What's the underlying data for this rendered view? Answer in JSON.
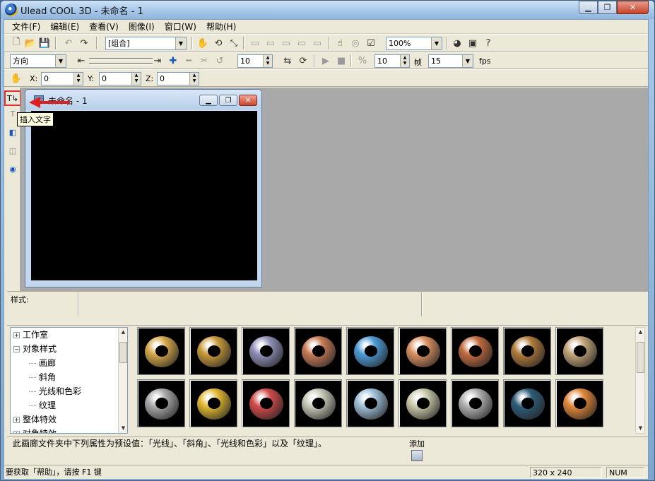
{
  "window": {
    "title": "Ulead COOL 3D - 未命名 - 1",
    "minimize": "▁",
    "maximize": "❐",
    "close": "✕"
  },
  "menubar": {
    "items": [
      "文件(F)",
      "编辑(E)",
      "查看(V)",
      "图像(I)",
      "窗口(W)",
      "帮助(H)"
    ]
  },
  "toolbar1": {
    "object_combo": "[组合]",
    "zoom_combo": "100%"
  },
  "toolbar2": {
    "path_combo": "方向",
    "frame_spin": "10",
    "frame_count_spin": "10",
    "frame_label": "帧",
    "fps_combo": "15",
    "fps_label": "fps"
  },
  "toolbar3": {
    "x_label": "X:",
    "x_value": "0",
    "y_label": "Y:",
    "y_value": "0",
    "z_label": "Z:",
    "z_value": "0"
  },
  "left_tools": {
    "tooltip": "插入文字"
  },
  "document": {
    "title": "未命名 - 1"
  },
  "style_bar": {
    "label": "样式:"
  },
  "tree": {
    "items": [
      {
        "label": "工作室",
        "level": 0,
        "expander": "+"
      },
      {
        "label": "对象样式",
        "level": 0,
        "expander": "−"
      },
      {
        "label": "画廊",
        "level": 1,
        "expander": ""
      },
      {
        "label": "斜角",
        "level": 1,
        "expander": ""
      },
      {
        "label": "光线和色彩",
        "level": 1,
        "expander": ""
      },
      {
        "label": "纹理",
        "level": 1,
        "expander": ""
      },
      {
        "label": "整体特效",
        "level": 0,
        "expander": "+"
      },
      {
        "label": "对象特效",
        "level": 0,
        "expander": "+"
      }
    ]
  },
  "gallery": {
    "thumbs": [
      {
        "color": "#d6a94a"
      },
      {
        "color": "#c99a3a"
      },
      {
        "color": "#8f8fb8"
      },
      {
        "color": "#c77a55"
      },
      {
        "color": "#4d9bd6"
      },
      {
        "color": "#d99060"
      },
      {
        "color": "#c06a3e"
      },
      {
        "color": "#b07a3a"
      },
      {
        "color": "#c2a57a"
      },
      {
        "color": "#a8a8a8"
      },
      {
        "color": "#e2b830"
      },
      {
        "color": "#d04a4a"
      },
      {
        "color": "#c8c8b8"
      },
      {
        "color": "#9ebfd8"
      },
      {
        "color": "#c9c8a8"
      },
      {
        "color": "#b0b0b0"
      },
      {
        "color": "#2e5c78"
      },
      {
        "color": "#e0873a"
      }
    ]
  },
  "description": {
    "text": "此画廊文件夹中下列属性为预设值：「光线」、「斜角」、「光线和色彩」以及「纹理」。",
    "add_label": "添加"
  },
  "statusbar": {
    "help_text": "要获取「帮助」，请按 F1 键",
    "size": "320 x 240",
    "num": "NUM"
  }
}
